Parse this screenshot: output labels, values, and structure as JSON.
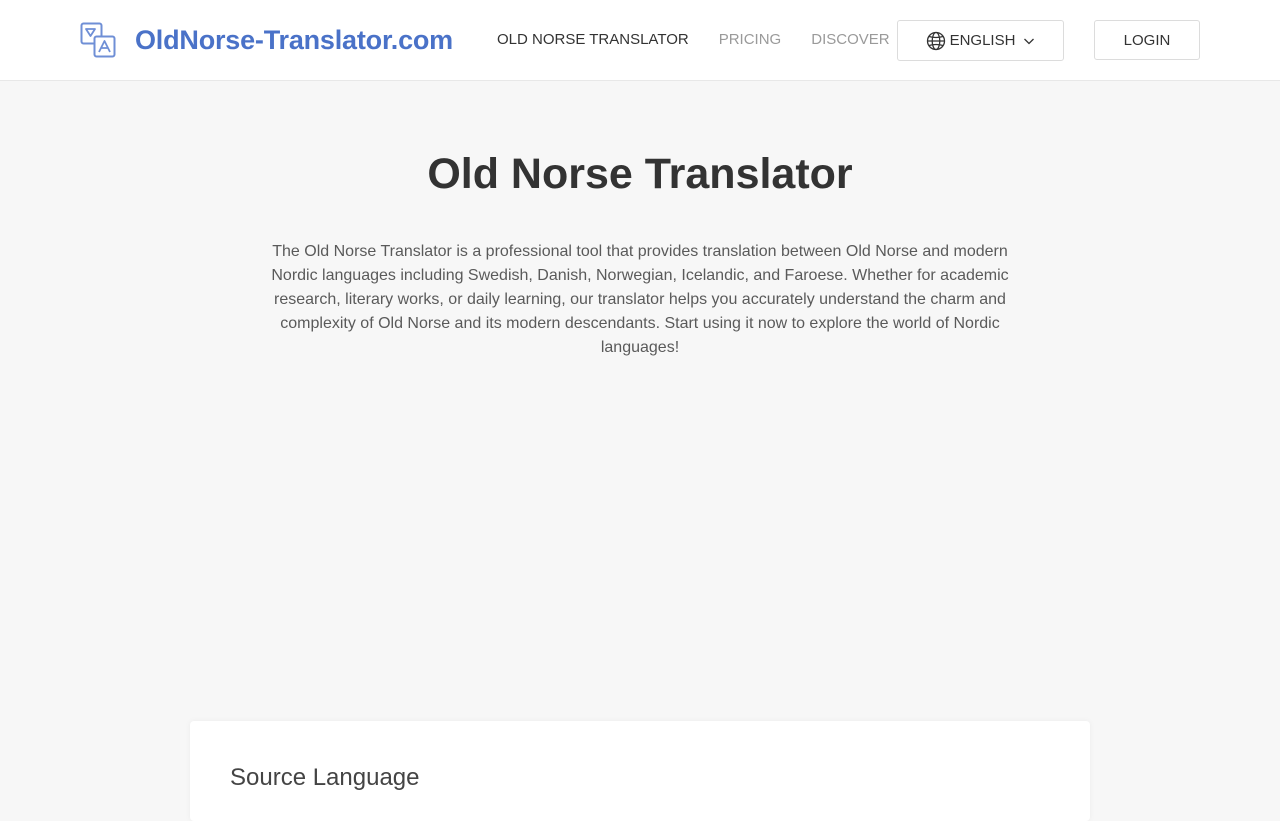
{
  "header": {
    "logo_text": "OldNorse-Translator.com",
    "logo_icon": "translate-icon",
    "nav": [
      {
        "label": "OLD NORSE TRANSLATOR",
        "active": true
      },
      {
        "label": "PRICING",
        "active": false
      },
      {
        "label": "DISCOVER",
        "active": false
      }
    ],
    "language": {
      "label": "ENGLISH",
      "icon": "globe-icon",
      "caret": "chevron-down-icon"
    },
    "login_label": "LOGIN"
  },
  "main": {
    "title": "Old Norse Translator",
    "intro": "The Old Norse Translator is a professional tool that provides translation between Old Norse and modern Nordic languages including Swedish, Danish, Norwegian, Icelandic, and Faroese. Whether for academic research, literary works, or daily learning, our translator helps you accurately understand the charm and complexity of Old Norse and its modern descendants. Start using it now to explore the world of Nordic languages!",
    "source_language_label": "Source Language"
  },
  "colors": {
    "brand": "#4a72c8",
    "page_background": "#f7f7f7",
    "header_background": "#ffffff",
    "nav_inactive": "#9a9a9a",
    "text_primary": "#333333"
  }
}
